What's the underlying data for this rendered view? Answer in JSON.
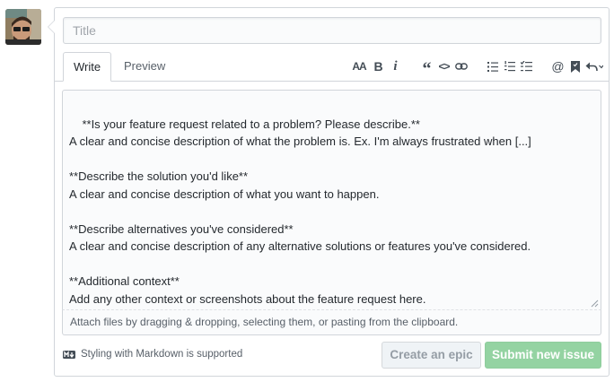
{
  "avatar": {
    "alt": "user avatar"
  },
  "form": {
    "title_placeholder": "Title",
    "title_value": ""
  },
  "tabs": [
    {
      "label": "Write",
      "active": true
    },
    {
      "label": "Preview",
      "active": false
    }
  ],
  "toolbar": {
    "heading": "AA",
    "bold": "B",
    "italic": "i",
    "quote": "“",
    "code": "<>",
    "icons": [
      "text-size-icon",
      "bold-icon",
      "italic-icon",
      "quote-icon",
      "code-icon",
      "link-icon",
      "unordered-list-icon",
      "ordered-list-icon",
      "task-list-icon",
      "mention-icon",
      "reference-icon",
      "reply-icon"
    ]
  },
  "editor": {
    "body": "**Is your feature request related to a problem? Please describe.**\nA clear and concise description of what the problem is. Ex. I'm always frustrated when [...]\n\n**Describe the solution you'd like**\nA clear and concise description of what you want to happen.\n\n**Describe alternatives you've considered**\nA clear and concise description of any alternative solutions or features you've considered.\n\n**Additional context**\nAdd any other context or screenshots about the feature request here.",
    "attach_hint": "Attach files by dragging & dropping, selecting them, or pasting from the clipboard."
  },
  "footer": {
    "markdown_note": "Styling with Markdown is supported",
    "epic_button": "Create an epic",
    "submit_button": "Submit new issue"
  },
  "colors": {
    "submit_bg": "#94d3a2",
    "border": "#d1d5da",
    "editor_bg": "#fafbfc"
  }
}
